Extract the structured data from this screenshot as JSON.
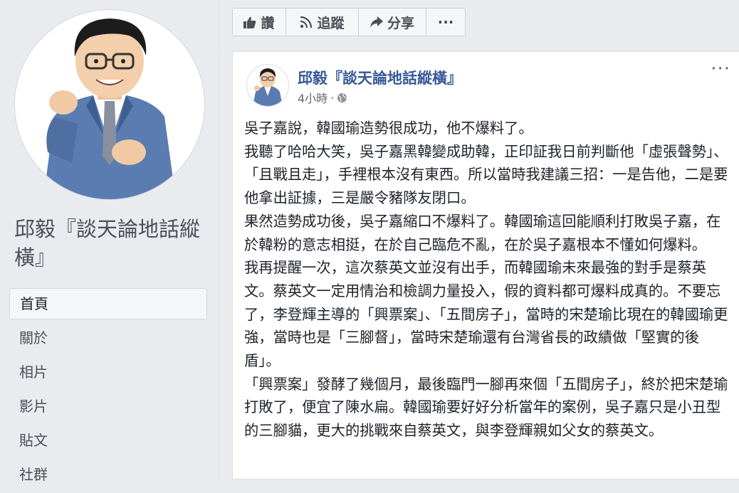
{
  "sidebar": {
    "page_name": "邱毅『談天論地話縱橫』",
    "nav_items": [
      {
        "label": "首頁",
        "active": true
      },
      {
        "label": "關於"
      },
      {
        "label": "相片"
      },
      {
        "label": "影片"
      },
      {
        "label": "貼文"
      },
      {
        "label": "社群"
      }
    ]
  },
  "actionbar": {
    "like_label": "讚",
    "follow_label": "追蹤",
    "share_label": "分享",
    "more_label": "···"
  },
  "post": {
    "author": "邱毅『談天論地話縱橫』",
    "time": "4小時",
    "privacy_icon": "globe-icon",
    "more_label": "···",
    "paragraphs": [
      "吳子嘉說，韓國瑜造勢很成功，他不爆料了。",
      "我聽了哈哈大笑，吳子嘉黑韓變成助韓，正印証我日前判斷他「虛張聲勢」、「且戰且走」，手裡根本沒有東西。所以當時我建議三招：一是告他，二是要他拿出証據，三是嚴令豬隊友閉口。",
      "果然造勢成功後，吳子嘉縮口不爆料了。韓國瑜這回能順利打敗吳子嘉，在於韓粉的意志相挺，在於自己臨危不亂，在於吳子嘉根本不懂如何爆料。",
      "我再提醒一次，這次蔡英文並沒有出手，而韓國瑜未來最強的對手是蔡英文。蔡英文一定用情治和檢調力量投入，假的資料都可爆料成真的。不要忘了，李登輝主導的「興票案」、「五間房子」，當時的宋楚瑜比現在的韓國瑜更強，當時也是「三腳督」，當時宋楚瑜還有台灣省長的政績做「堅實的後盾」。",
      "「興票案」發酵了幾個月，最後臨門一腳再來個「五間房子」，終於把宋楚瑜打敗了，便宜了陳水扁。韓國瑜要好好分析當年的案例，吳子嘉只是小丑型的三腳貓，更大的挑戰來自蔡英文，與李登輝親如父女的蔡英文。"
    ]
  },
  "colors": {
    "background": "#e9ebee",
    "link_blue": "#365899",
    "text": "#1d2129",
    "muted": "#616770"
  }
}
